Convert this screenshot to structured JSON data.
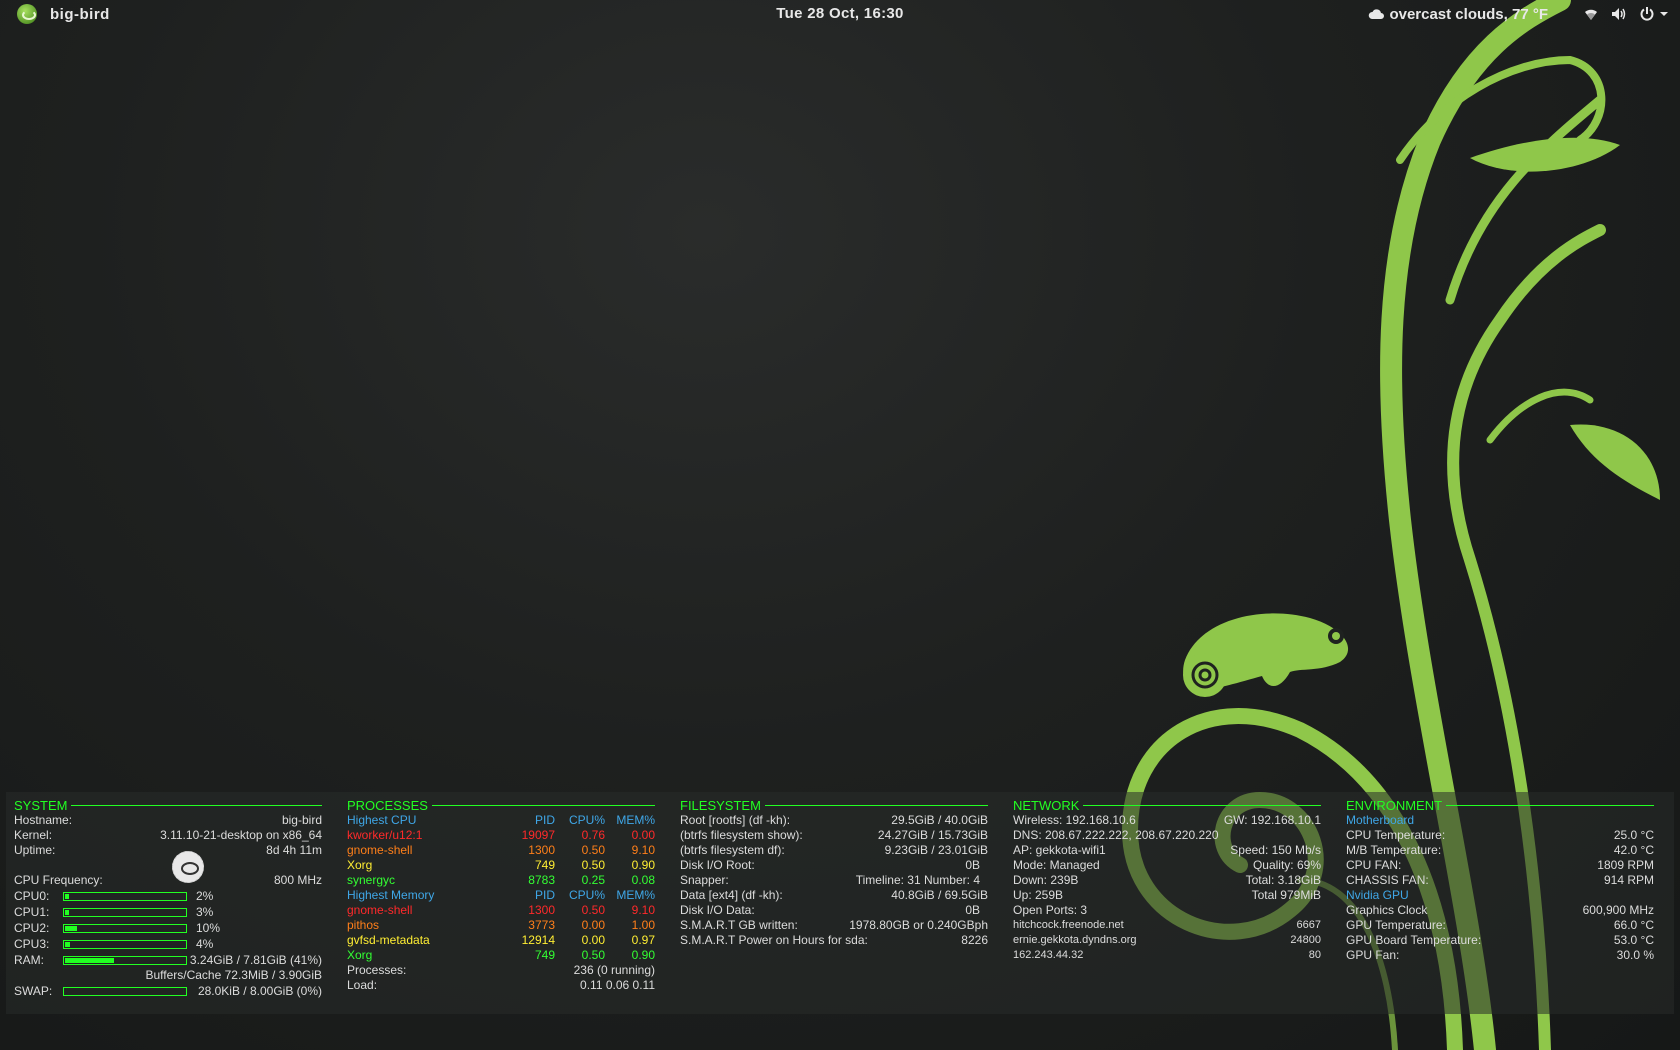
{
  "topbar": {
    "app_name": "big-bird",
    "clock": "Tue 28 Oct, 16:30",
    "weather": "overcast clouds, 77 °F",
    "icons": [
      "cloud-icon",
      "wifi-icon",
      "volume-icon",
      "power-icon",
      "chevron-down-icon"
    ]
  },
  "colors": {
    "accent_green": "#22ff22",
    "header_blue": "#3fa7e8",
    "rank1_red": "#ff2a2a",
    "rank2_orange": "#ff7f1a",
    "rank3_yellow": "#ffee33",
    "rank4_green": "#33ff33",
    "wallpaper_leaf": "#8fc74a"
  },
  "system": {
    "title": "SYSTEM",
    "hostname_label": "Hostname:",
    "hostname": "big-bird",
    "kernel_label": "Kernel:",
    "kernel": "3.11.10-21-desktop on x86_64",
    "uptime_label": "Uptime:",
    "uptime": "8d 4h 11m",
    "cpufreq_label": "CPU Frequency:",
    "cpufreq": "800 MHz",
    "cpus": [
      {
        "label": "CPU0:",
        "value": "2%",
        "level": 2
      },
      {
        "label": "CPU1:",
        "value": "3%",
        "level": 3
      },
      {
        "label": "CPU2:",
        "value": "10%",
        "level": 10
      },
      {
        "label": "CPU3:",
        "value": "4%",
        "level": 4
      }
    ],
    "ram_label": "RAM:",
    "ram": "3.24GiB / 7.81GiB (41%)",
    "ram_level": 41,
    "buffers": "Buffers/Cache 72.3MiB / 3.90GiB",
    "swap_label": "SWAP:",
    "swap": "28.0KiB / 8.00GiB (0%)",
    "swap_level": 0
  },
  "processes": {
    "title": "PROCESSES",
    "cpu_header": {
      "name": "Highest CPU",
      "pid": "PID",
      "cpu": "CPU%",
      "mem": "MEM%"
    },
    "cpu_rows": [
      {
        "name": "kworker/u12:1",
        "pid": "19097",
        "cpu": "0.76",
        "mem": "0.00"
      },
      {
        "name": "gnome-shell",
        "pid": "1300",
        "cpu": "0.50",
        "mem": "9.10"
      },
      {
        "name": "Xorg",
        "pid": "749",
        "cpu": "0.50",
        "mem": "0.90"
      },
      {
        "name": "synergyc",
        "pid": "8783",
        "cpu": "0.25",
        "mem": "0.08"
      }
    ],
    "mem_header": {
      "name": "Highest Memory",
      "pid": "PID",
      "cpu": "CPU%",
      "mem": "MEM%"
    },
    "mem_rows": [
      {
        "name": "gnome-shell",
        "pid": "1300",
        "cpu": "0.50",
        "mem": "9.10"
      },
      {
        "name": "pithos",
        "pid": "3773",
        "cpu": "0.00",
        "mem": "1.00"
      },
      {
        "name": "gvfsd-metadata",
        "pid": "12914",
        "cpu": "0.00",
        "mem": "0.97"
      },
      {
        "name": "Xorg",
        "pid": "749",
        "cpu": "0.50",
        "mem": "0.90"
      }
    ],
    "processes_label": "Processes:",
    "processes": "236 (0 running)",
    "load_label": "Load:",
    "load": "0.11 0.06 0.11"
  },
  "filesystem": {
    "title": "FILESYSTEM",
    "rows": [
      {
        "label": "Root [rootfs] (df -kh):",
        "value": "29.5GiB / 40.0GiB"
      },
      {
        "label": "(btrfs filesystem show):",
        "value": "24.27GiB / 15.73GiB"
      },
      {
        "label": "(btrfs filesystem df):",
        "value": "9.23GiB / 23.01GiB"
      },
      {
        "label": "Disk I/O Root:",
        "value": "0B"
      },
      {
        "label": "Snapper:",
        "value": "Timeline: 31 Number: 4"
      },
      {
        "label": "Data [ext4] (df -kh):",
        "value": "40.8GiB / 69.5GiB"
      },
      {
        "label": "Disk I/O Data:",
        "value": "0B"
      },
      {
        "label": "S.M.A.R.T GB written:",
        "value": "1978.80GB or 0.240GBph"
      },
      {
        "label": "S.M.A.R.T Power on Hours for sda:",
        "value": "8226"
      }
    ]
  },
  "network": {
    "title": "NETWORK",
    "rows": [
      {
        "label": "Wireless: 192.168.10.6",
        "value": "GW: 192.168.10.1"
      },
      {
        "label": "DNS: 208.67.222.222, 208.67.220.220",
        "value": ""
      },
      {
        "label": "AP: gekkota-wifi1",
        "value": "Speed: 150 Mb/s"
      },
      {
        "label": "Mode: Managed",
        "value": "Quality: 69%"
      },
      {
        "label": "Down: 239B",
        "value": "Total: 3.18GiB"
      },
      {
        "label": "Up: 259B",
        "value": "Total 979MiB"
      },
      {
        "label": "Open Ports: 3",
        "value": ""
      },
      {
        "label": "hitchcock.freenode.net",
        "value": "6667"
      },
      {
        "label": "ernie.gekkota.dyndns.org",
        "value": "24800"
      },
      {
        "label": "162.243.44.32",
        "value": "80"
      }
    ]
  },
  "environment": {
    "title": "ENVIRONMENT",
    "motherboard_header": "Motherboard",
    "motherboard_rows": [
      {
        "label": "CPU Temperature:",
        "value": "25.0 °C"
      },
      {
        "label": "M/B Temperature:",
        "value": "42.0 °C"
      },
      {
        "label": "CPU FAN:",
        "value": "1809 RPM"
      },
      {
        "label": "CHASSIS FAN:",
        "value": "914 RPM"
      }
    ],
    "gpu_header": "Nvidia GPU",
    "gpu_rows": [
      {
        "label": "Graphics Clock",
        "value": "600,900 MHz"
      },
      {
        "label": "GPU Temperature:",
        "value": "66.0 °C"
      },
      {
        "label": "GPU Board Temperature:",
        "value": "53.0 °C"
      },
      {
        "label": "GPU Fan:",
        "value": "30.0 %"
      }
    ]
  }
}
